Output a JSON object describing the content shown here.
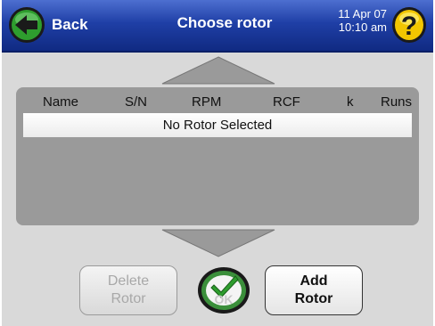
{
  "header": {
    "back_label": "Back",
    "title": "Choose rotor",
    "date": "11 Apr 07",
    "time": "10:10 am",
    "help_glyph": "?"
  },
  "table": {
    "columns": [
      "Name",
      "S/N",
      "RPM",
      "RCF",
      "k",
      "Runs"
    ],
    "selected_row": "No Rotor Selected"
  },
  "buttons": {
    "delete_line1": "Delete",
    "delete_line2": "Rotor",
    "ok_label": "OK",
    "add_line1": "Add",
    "add_line2": "Rotor"
  },
  "colors": {
    "header_blue": "#1f3fa6",
    "back_green": "#2e9d2e",
    "help_yellow": "#f2c600",
    "panel_gray": "#9a9a9a",
    "ok_green": "#3b8f3b"
  },
  "icons": {
    "back": "left-arrow-icon",
    "help": "question-mark-icon",
    "scroll_up": "up-arrow-icon",
    "scroll_down": "down-arrow-icon",
    "ok": "check-icon"
  }
}
